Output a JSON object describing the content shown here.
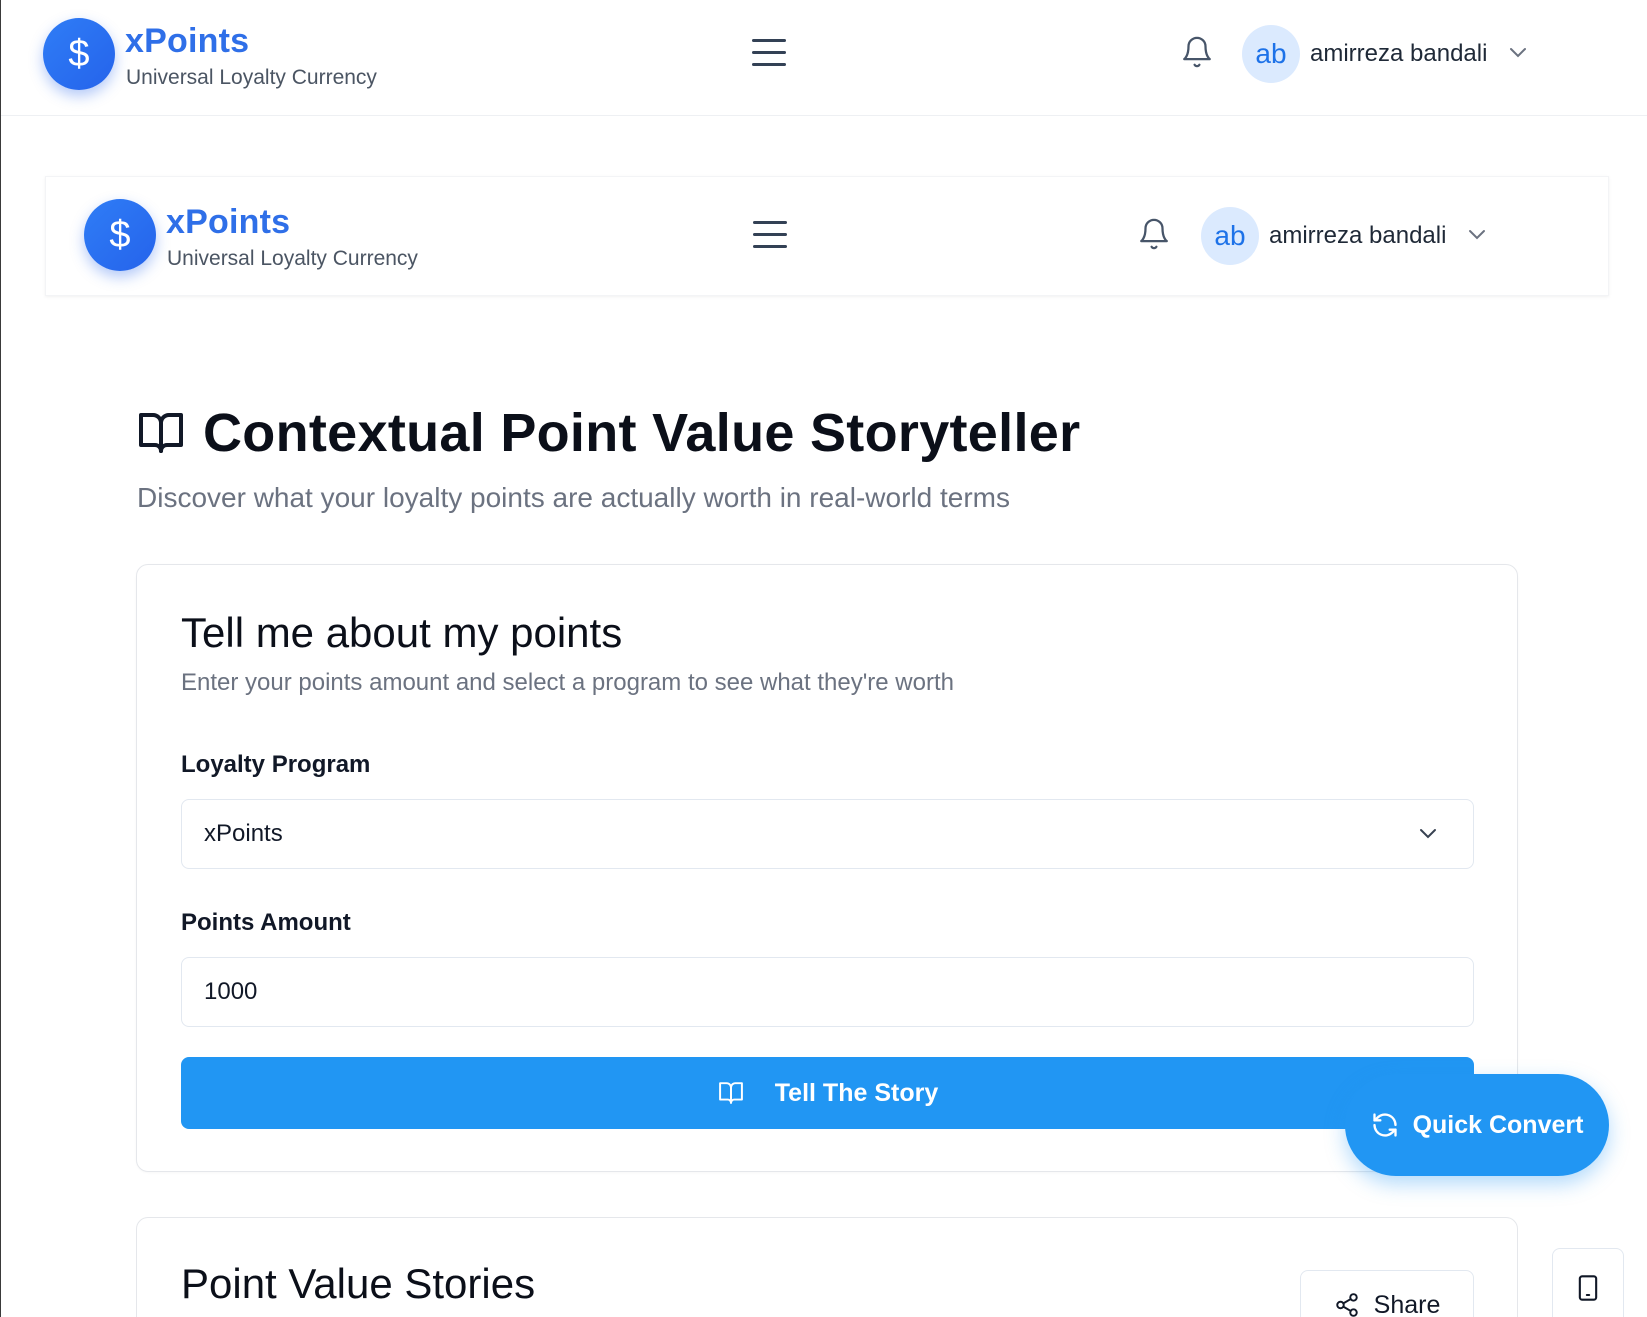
{
  "brand": {
    "name": "xPoints",
    "tagline": "Universal Loyalty Currency",
    "logo_symbol": "$"
  },
  "user": {
    "initials": "ab",
    "name": "amirreza bandali"
  },
  "page": {
    "title": "Contextual Point Value Storyteller",
    "subtitle": "Discover what your loyalty points are actually worth in real-world terms"
  },
  "form_card": {
    "title": "Tell me about my points",
    "subtitle": "Enter your points amount and select a program to see what they're worth",
    "program_label": "Loyalty Program",
    "program_value": "xPoints",
    "amount_label": "Points Amount",
    "amount_value": "1000",
    "submit_label": "Tell The Story"
  },
  "quick_convert_label": "Quick Convert",
  "stories_card": {
    "title": "Point Value Stories",
    "share_label": "Share"
  },
  "colors": {
    "accent": "#2196f3",
    "brand": "#2f6fe8",
    "avatar_bg": "#dbeafe"
  },
  "icons": {
    "logo": "dollar-icon",
    "menu": "hamburger-icon",
    "notifications": "bell-icon",
    "user_menu": "chevron-down-icon",
    "title": "book-open-icon",
    "convert": "refresh-icon",
    "share": "share-icon",
    "device": "tablet-icon"
  }
}
